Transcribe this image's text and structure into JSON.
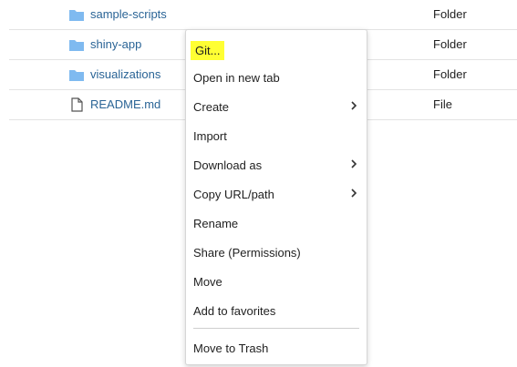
{
  "files": [
    {
      "name": "sample-scripts",
      "type": "Folder",
      "icon": "folder-icon"
    },
    {
      "name": "shiny-app",
      "type": "Folder",
      "icon": "folder-icon"
    },
    {
      "name": "visualizations",
      "type": "Folder",
      "icon": "folder-icon"
    },
    {
      "name": "README.md",
      "type": "File",
      "icon": "file-icon"
    }
  ],
  "context_menu": {
    "git": "Git...",
    "open_new_tab": "Open in new tab",
    "create": "Create",
    "import": "Import",
    "download_as": "Download as",
    "copy_url": "Copy URL/path",
    "rename": "Rename",
    "share": "Share (Permissions)",
    "move": "Move",
    "add_favorites": "Add to favorites",
    "move_to_trash": "Move to Trash"
  },
  "colors": {
    "folder": "#7fbaf0",
    "link": "#2a6496",
    "highlight": "#ffff33"
  }
}
